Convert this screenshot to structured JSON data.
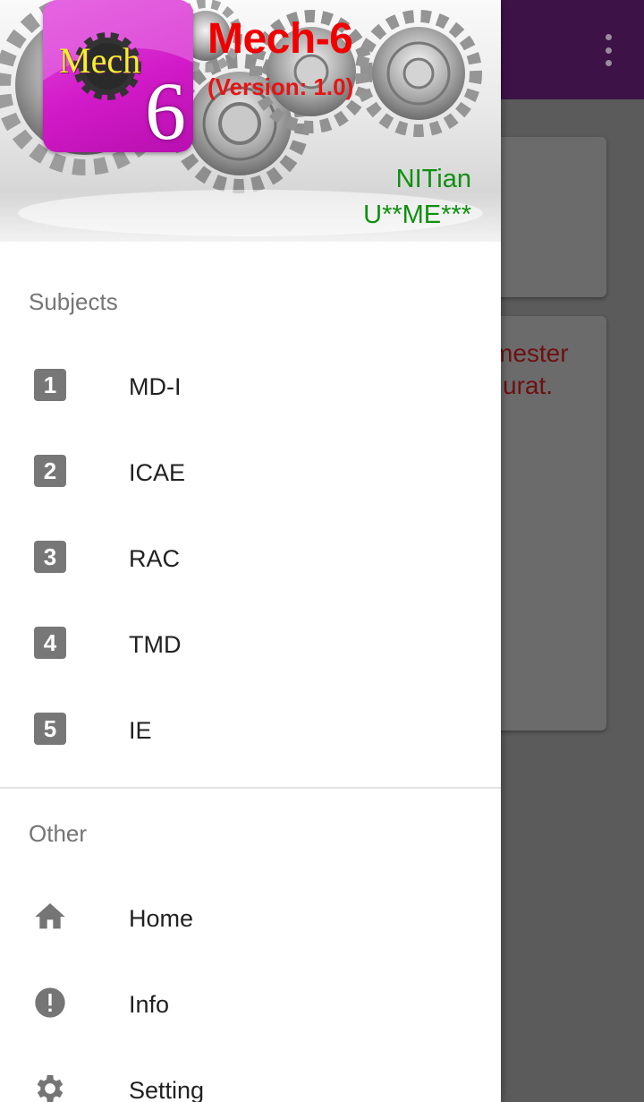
{
  "background": {
    "card_text_lines": [
      "mester",
      "urat."
    ]
  },
  "drawer": {
    "header": {
      "logo_word": "Mech",
      "logo_number": "6",
      "title": "Mech-6",
      "version": "(Version: 1.0)",
      "line1": "NITian",
      "line2": "U**ME***"
    },
    "subjects_label": "Subjects",
    "subjects": [
      {
        "num": "1",
        "label": "MD-I"
      },
      {
        "num": "2",
        "label": "ICAE"
      },
      {
        "num": "3",
        "label": "RAC"
      },
      {
        "num": "4",
        "label": "TMD"
      },
      {
        "num": "5",
        "label": "IE"
      }
    ],
    "other_label": "Other",
    "other": [
      {
        "icon": "home-icon",
        "label": "Home"
      },
      {
        "icon": "info-icon",
        "label": "Info"
      },
      {
        "icon": "gear-icon",
        "label": "Setting"
      }
    ]
  },
  "colors": {
    "app_bar": "#3d1247",
    "title_red": "#f00000",
    "header_green": "#109010",
    "card_text": "#6e1010"
  }
}
